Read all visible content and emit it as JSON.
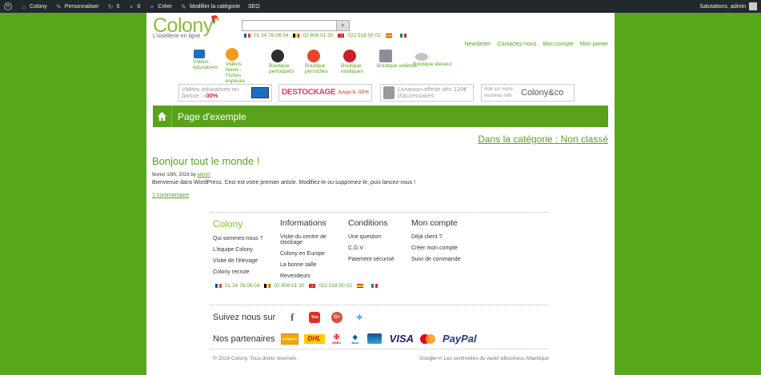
{
  "adminbar": {
    "site": "Colony",
    "customize": "Personnaliser",
    "updates": "5",
    "comments": "0",
    "new": "Créer",
    "edit_category": "Modifier la catégorie",
    "seo": "SEO",
    "greeting": "Salutations, admin"
  },
  "header": {
    "logo": "Colony",
    "tagline": "L'oisellerie en ligne",
    "search_placeholder": "",
    "phones": [
      {
        "country": "fr",
        "number": "01 34 76 06 04"
      },
      {
        "country": "be",
        "number": "02 808 01 30"
      },
      {
        "country": "ch",
        "number": "022 518 00 02"
      },
      {
        "country": "es",
        "number": ""
      },
      {
        "country": "it",
        "number": ""
      }
    ],
    "toplinks": [
      "Newsletter",
      "Contactez-nous",
      "Mon compte",
      "Mon panier"
    ]
  },
  "categories": [
    {
      "label": "Vidéos éducatives",
      "icon": "monitor-icon"
    },
    {
      "label": "Vidéos News - Fiches espèces",
      "icon": "play-icon"
    },
    {
      "label": "Boutique perroquets",
      "icon": "parrot-icon"
    },
    {
      "label": "Boutique perruches",
      "icon": "parakeet-icon"
    },
    {
      "label": "Boutique exotiques",
      "icon": "exotic-bird-icon"
    },
    {
      "label": "Boutique volières",
      "icon": "aviary-icon"
    },
    {
      "label": "Boutique éleveur",
      "icon": "breeder-icon"
    }
  ],
  "banners": [
    {
      "text": "Vidéos éducatives en baisse :",
      "accent": "-30%"
    },
    {
      "text": "DESTOCKAGE",
      "accent": "Jusqu'à -50%"
    },
    {
      "text": "Livraison offerte dès 120€ d'accessoires",
      "accent": ""
    },
    {
      "text": "Rdv sur notre nouveau site",
      "accent": "Colony&co"
    }
  ],
  "titlebar": {
    "title": "Page d'exemple"
  },
  "category_link": {
    "prefix": "Dans la catégorie :",
    "name": "Non classé"
  },
  "post": {
    "title": "Bonjour tout le monde !",
    "date": "février 10th, 2016",
    "by": "by",
    "author": "admin",
    "content": "Bienvenue dans WordPress. Ceci est votre premier article. Modifiez-le ou supprimez-le, puis lancez-vous !",
    "comments": "1 commentaire"
  },
  "footer": {
    "logo": "Colony",
    "about": [
      "Qui sommes-nous ?",
      "L'équipe Colony",
      "Visite de l'élevage",
      "Colony recrute"
    ],
    "info_title": "Informations",
    "info": [
      "Visite du centre de stockage",
      "Colony en Europe",
      "La bonne taille",
      "Revendeurs"
    ],
    "cond_title": "Conditions",
    "cond": [
      "Une question",
      "C.G.V",
      "Paiement sécurisé"
    ],
    "account_title": "Mon compte",
    "account": [
      "Déjà client ?",
      "Créer mon compte",
      "Suivi de commande"
    ],
    "follow": "Suivez nous sur",
    "social": [
      "facebook-icon",
      "youtube-icon",
      "google-plus-icon",
      "twitter-icon"
    ],
    "partners_label": "Nos partenaires",
    "partners": [
      "Colissimo",
      "DHL",
      "HSBC",
      "Atos",
      "Carte bleue",
      "VISA",
      "Mastercard",
      "PayPal"
    ],
    "copyright": "© 2016 Colony. Tous droits réservés.",
    "credits": "Google+// Les sentinelles du web// eBusiness Atlantique"
  },
  "colors": {
    "background": "#56a81a",
    "accent": "#5aa21c",
    "adminbar": "#23282d"
  }
}
